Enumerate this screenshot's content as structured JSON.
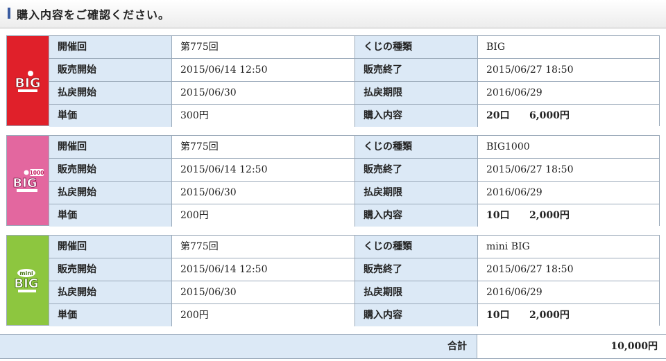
{
  "header": {
    "title": "購入内容をご確認ください。"
  },
  "labels": {
    "round": "開催回",
    "type": "くじの種類",
    "sale_start": "販売開始",
    "sale_end": "販売終了",
    "payout_start": "払戻開始",
    "payout_deadline": "払戻期限",
    "unit_price": "単価",
    "purchase": "購入内容"
  },
  "tickets": [
    {
      "logo": {
        "text": "BIG",
        "color": "#e0202a"
      },
      "round": "第775回",
      "type": "BIG",
      "sale_start": "2015/06/14 12:50",
      "sale_end": "2015/06/27 18:50",
      "payout_start": "2015/06/30",
      "payout_deadline": "2016/06/29",
      "unit_price": "300円",
      "quantity": "20口",
      "amount": "6,000円"
    },
    {
      "logo": {
        "text": "BIG",
        "badge": "1000",
        "color": "#e3679f"
      },
      "round": "第775回",
      "type": "BIG1000",
      "sale_start": "2015/06/14 12:50",
      "sale_end": "2015/06/27 18:50",
      "payout_start": "2015/06/30",
      "payout_deadline": "2016/06/29",
      "unit_price": "200円",
      "quantity": "10口",
      "amount": "2,000円"
    },
    {
      "logo": {
        "text": "BIG",
        "badge": "mini",
        "color": "#8dc63f"
      },
      "round": "第775回",
      "type": "mini BIG",
      "sale_start": "2015/06/14 12:50",
      "sale_end": "2015/06/27 18:50",
      "payout_start": "2015/06/30",
      "payout_deadline": "2016/06/29",
      "unit_price": "200円",
      "quantity": "10口",
      "amount": "2,000円"
    }
  ],
  "total": {
    "label": "合計",
    "value": "10,000円"
  }
}
